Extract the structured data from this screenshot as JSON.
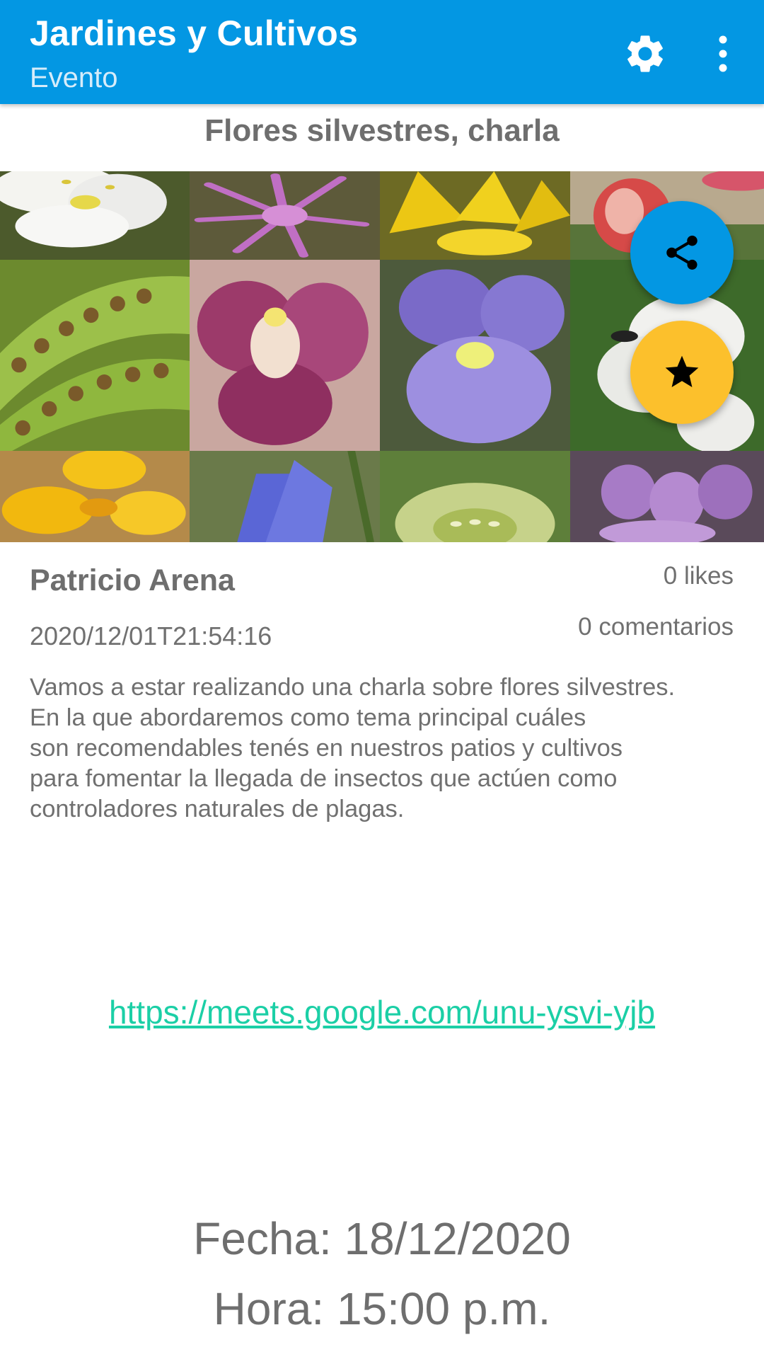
{
  "appbar": {
    "title": "Jardines y Cultivos",
    "subtitle": "Evento",
    "settings_icon": "gear-icon",
    "more_icon": "more-vertical-icon",
    "color": "#0397e3"
  },
  "event": {
    "title": "Flores silvestres, charla",
    "author": "Patricio Arena",
    "timestamp": "2020/12/01T21:54:16",
    "likes": "0 likes",
    "comments": "0 comentarios",
    "description_lines": [
      "Vamos a estar realizando una charla sobre flores silvestres.",
      "En la que abordaremos como tema principal cuáles",
      "son recomendables tenés en nuestros patios y cultivos",
      "para fomentar la llegada de insectos que actúen como",
      "controladores naturales de plagas."
    ],
    "link": "https://meets.google.com/unu-ysvi-yjb",
    "fecha": "Fecha: 18/12/2020",
    "hora": "Hora: 15:00 p.m."
  },
  "gallery": {
    "tiles": [
      "white-flower",
      "pink-fringed-flower",
      "yellow-flower",
      "red-bud",
      "fern-sori",
      "pink-orchid",
      "purple-toadflax",
      "white-lily",
      "yellow-rockrose",
      "blue-gentian",
      "green-hellebore",
      "purple-orchid"
    ]
  },
  "fabs": {
    "share_icon": "share-icon",
    "share_color": "#0397e3",
    "favorite_icon": "star-icon",
    "favorite_color": "#fcc02c"
  },
  "colors": {
    "link": "#1bcfa6",
    "text": "#6e6e6e"
  }
}
